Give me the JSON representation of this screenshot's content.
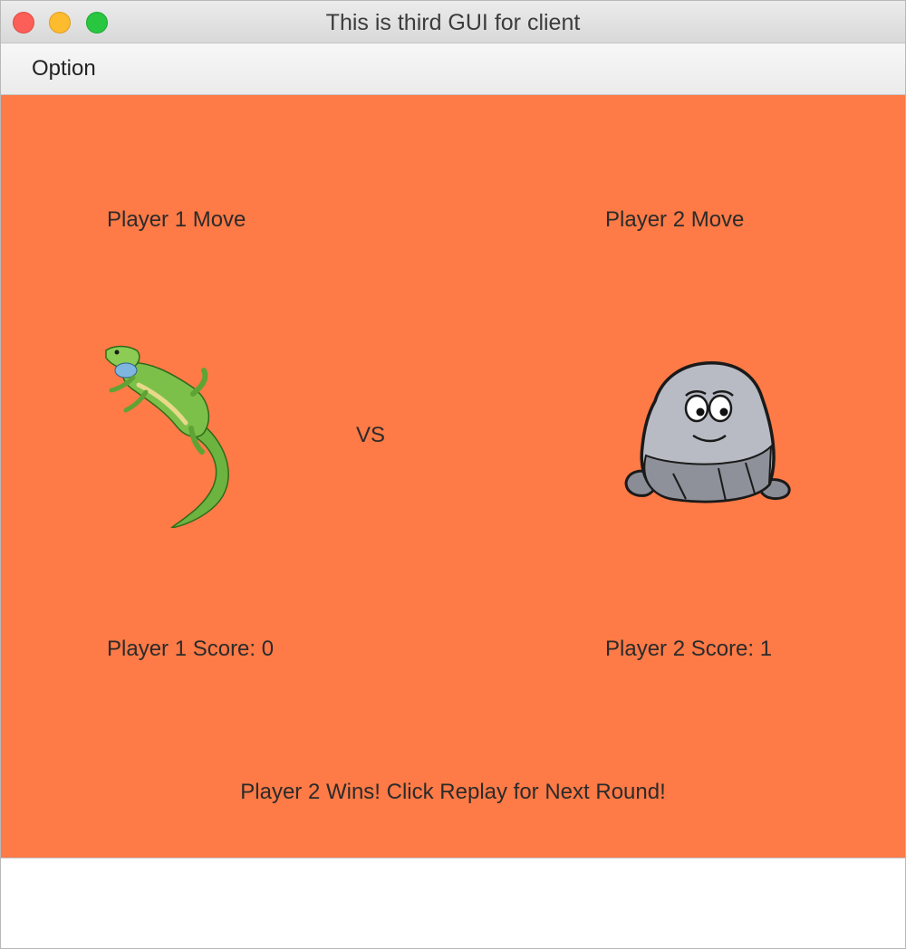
{
  "window": {
    "title": "This is third GUI for client"
  },
  "menu": {
    "items": [
      "Option"
    ]
  },
  "game": {
    "player1_move_label": "Player 1 Move",
    "player2_move_label": "Player 2 Move",
    "vs_label": "VS",
    "player1_move_icon": "lizard-icon",
    "player2_move_icon": "rock-icon",
    "player1_score_label": "Player 1 Score: 0",
    "player2_score_label": "Player 2 Score: 1",
    "result_message": "Player 2 Wins! Click Replay for Next Round!",
    "background_color": "#fe7a46"
  }
}
